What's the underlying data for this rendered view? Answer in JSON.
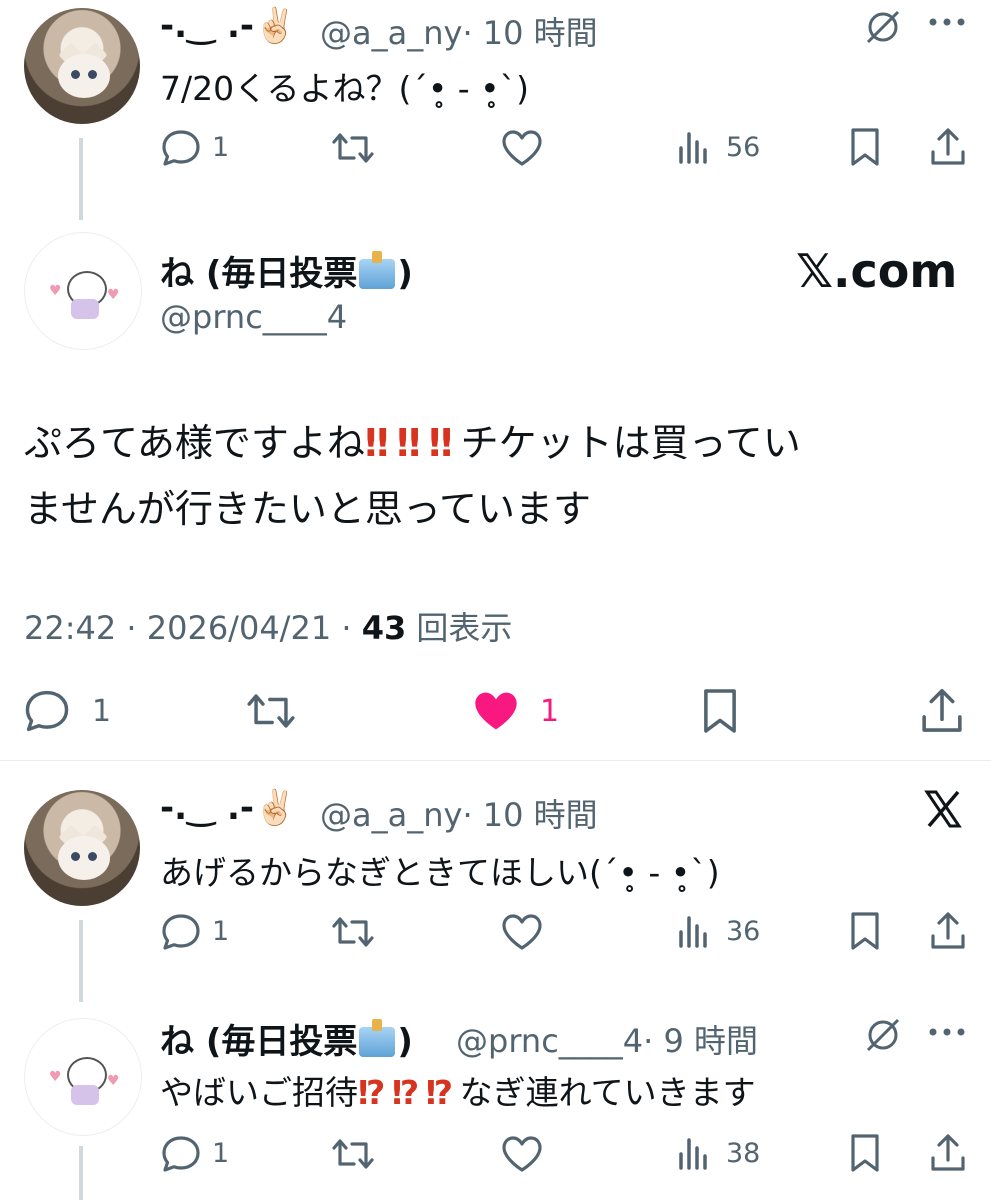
{
  "tweet1": {
    "display_name": "-.‿ .-✌🏻",
    "handle": "@a_a_ny",
    "time": "· 10 時間",
    "text": "7/20くるよね？(ˊ•̥ - •̥ˋ)",
    "reply_count": "1",
    "views": "56"
  },
  "main_tweet": {
    "display_name": "ね (毎日投票",
    "display_name_end": ")",
    "handle": "@prnc____4",
    "brand": "𝕏.com",
    "text_line1_a": "ぷろてあ様ですよね",
    "bang": "‼︎",
    "text_line1_b": "チケットは買ってい",
    "text_line2": "ませんが行きたいと思っています",
    "timestamp": "22:42 · 2026/04/21 · ",
    "views": "43",
    "views_label": " 回表示",
    "reply_count": "1",
    "like_count": "1"
  },
  "tweet3": {
    "display_name": "-.‿ .-✌🏻",
    "handle": "@a_a_ny",
    "time": "· 10 時間",
    "text": "あげるからなぎときてほしい(ˊ•̥ - •̥ˋ)",
    "reply_count": "1",
    "views": "36"
  },
  "tweet4": {
    "display_name": "ね (毎日投票",
    "display_name_end": ")",
    "handle": "@prnc____4",
    "time": "· 9 時間",
    "text_a": "やばいご招待",
    "interrobang": "⁉︎",
    "text_b": "なぎ連れていきます",
    "reply_count": "1",
    "views": "38"
  },
  "colors": {
    "like_active": "#f91880",
    "icon_gray": "#536471",
    "text": "#0f1419"
  }
}
